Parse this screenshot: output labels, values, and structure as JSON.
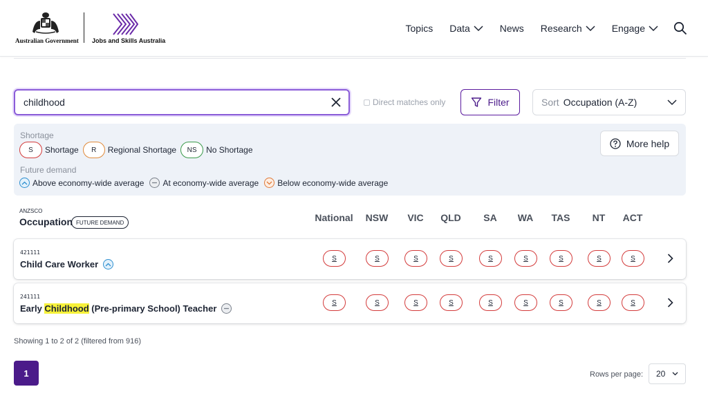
{
  "header": {
    "gov_name": "Australian Government",
    "agency_name": "Jobs and Skills Australia",
    "nav": [
      {
        "label": "Topics",
        "has_dropdown": false
      },
      {
        "label": "Data",
        "has_dropdown": true
      },
      {
        "label": "News",
        "has_dropdown": false
      },
      {
        "label": "Research",
        "has_dropdown": true
      },
      {
        "label": "Engage",
        "has_dropdown": true
      }
    ],
    "search_icon": "search-icon"
  },
  "search": {
    "value": "childhood",
    "direct_match_label": "Direct matches only",
    "direct_match_checked": false,
    "filter_label": "Filter",
    "sort_label": "Sort",
    "sort_value": "Occupation (A-Z)"
  },
  "legend": {
    "shortage_title": "Shortage",
    "shortage_items": [
      {
        "code": "S",
        "label": "Shortage"
      },
      {
        "code": "R",
        "label": "Regional Shortage"
      },
      {
        "code": "NS",
        "label": "No Shortage"
      }
    ],
    "demand_title": "Future demand",
    "demand_items": [
      {
        "label": "Above economy-wide average"
      },
      {
        "label": "At economy-wide average"
      },
      {
        "label": "Below economy-wide average"
      }
    ],
    "help_label": "More help"
  },
  "table": {
    "anzsco_label": "ANZSCO",
    "occupation_label": "Occupation",
    "future_demand_tag": "FUTURE DEMAND",
    "columns": [
      "National",
      "NSW",
      "VIC",
      "QLD",
      "SA",
      "WA",
      "TAS",
      "NT",
      "ACT"
    ],
    "rows": [
      {
        "code": "421111",
        "title_pre": "Child Care Worker",
        "title_highlight": "",
        "title_post": "",
        "future_demand": "above",
        "ratings": [
          "S",
          "S",
          "S",
          "S",
          "S",
          "S",
          "S",
          "S",
          "S"
        ]
      },
      {
        "code": "241111",
        "title_pre": "Early ",
        "title_highlight": "Childhood",
        "title_post": " (Pre-primary School) Teacher",
        "future_demand": "at",
        "ratings": [
          "S",
          "S",
          "S",
          "S",
          "S",
          "S",
          "S",
          "S",
          "S"
        ]
      }
    ]
  },
  "pagination": {
    "showing_text": "Showing 1 to 2 of 2 (filtered from 916)",
    "current_page": "1",
    "rows_per_page_label": "Rows per page:",
    "rows_per_page_value": "20"
  },
  "colors": {
    "accent": "#4b1b8a",
    "shortage": "#d33a3a",
    "regional": "#e08a3a",
    "no_shortage": "#3a9a4a",
    "highlight": "#f7f23a"
  }
}
